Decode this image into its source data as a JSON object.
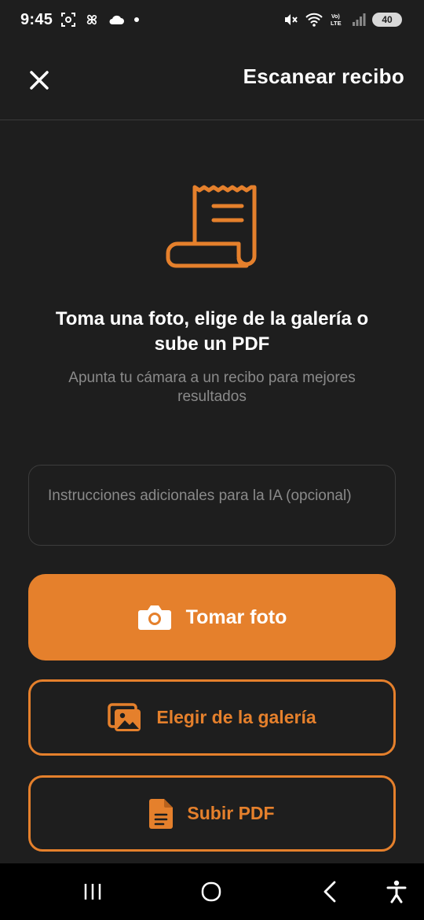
{
  "status_bar": {
    "time": "9:45",
    "battery": "40",
    "network_label": "LTE"
  },
  "header": {
    "title": "Escanear recibo",
    "close_icon": "close-icon"
  },
  "hero": {
    "icon": "receipt-icon",
    "headline_line1": "Toma una foto, elige de la galería o",
    "headline_line2": "sube un PDF",
    "subline_line1": "Apunta tu cámara a un recibo para mejores",
    "subline_line2": "resultados"
  },
  "instructions": {
    "placeholder": "Instrucciones adicionales para la IA (opcional)",
    "value": ""
  },
  "actions": {
    "take_photo": "Tomar foto",
    "gallery": "Elegir de la galería",
    "upload_pdf": "Subir PDF"
  },
  "colors": {
    "accent": "#e5802c",
    "background": "#1e1e1e"
  }
}
